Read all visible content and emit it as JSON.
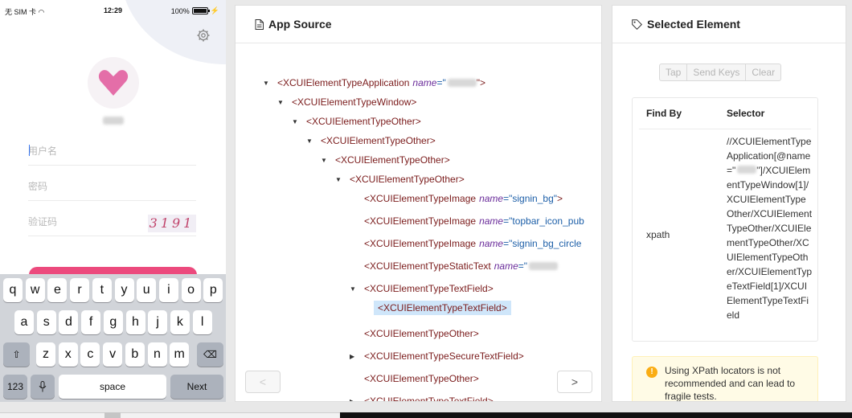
{
  "phone": {
    "status": {
      "carrier": "无 SIM 卡",
      "time": "12:29",
      "battery": "100%"
    },
    "fields": {
      "username_placeholder": "用户名",
      "password_placeholder": "密码",
      "captcha_placeholder": "验证码",
      "captcha_image_text": "3191"
    },
    "keyboard": {
      "row1": [
        "q",
        "w",
        "e",
        "r",
        "t",
        "y",
        "u",
        "i",
        "o",
        "p"
      ],
      "row2": [
        "a",
        "s",
        "d",
        "f",
        "g",
        "h",
        "j",
        "k",
        "l"
      ],
      "row3": [
        "z",
        "x",
        "c",
        "v",
        "b",
        "n",
        "m"
      ],
      "num_key": "123",
      "space_key": "space",
      "next_key": "Next"
    }
  },
  "app_source": {
    "title": "App Source",
    "nodes": [
      {
        "tag": "<XCUIElementTypeApplication",
        "attr": "name",
        "val": "=\"",
        "blur": true,
        "end": "\">",
        "arrow": "down"
      },
      {
        "tag": "<XCUIElementTypeWindow>",
        "arrow": "down"
      },
      {
        "tag": "<XCUIElementTypeOther>",
        "arrow": "down"
      },
      {
        "tag": "<XCUIElementTypeOther>",
        "arrow": "down"
      },
      {
        "tag": "<XCUIElementTypeOther>",
        "arrow": "down"
      },
      {
        "tag": "<XCUIElementTypeOther>",
        "arrow": "down"
      },
      {
        "tag": "<XCUIElementTypeImage",
        "attr": "name",
        "val": "=\"signin_bg\"",
        "end": ">"
      },
      {
        "tag": "<XCUIElementTypeImage",
        "attr": "name",
        "val": "=\"topbar_icon_pub",
        "end": ""
      },
      {
        "tag": "<XCUIElementTypeImage",
        "attr": "name",
        "val": "=\"signin_bg_circle",
        "end": ""
      },
      {
        "tag": "<XCUIElementTypeStaticText",
        "attr": "name",
        "val": "=\"",
        "blur": true,
        "end": ""
      },
      {
        "tag": "<XCUIElementTypeTextField>",
        "arrow": "down"
      },
      {
        "tag": "<XCUIElementTypeTextField>",
        "highlight": true
      },
      {
        "tag": "<XCUIElementTypeOther>"
      },
      {
        "tag": "<XCUIElementTypeSecureTextField>",
        "arrow": "right"
      },
      {
        "tag": "<XCUIElementTypeOther>"
      },
      {
        "tag": "<XCUIElementTypeTextField>",
        "arrow": "right"
      }
    ],
    "prev": "<",
    "next": ">"
  },
  "selected": {
    "title": "Selected Element",
    "actions": [
      "Tap",
      "Send Keys",
      "Clear"
    ],
    "table": {
      "col_find_by": "Find By",
      "col_selector": "Selector",
      "find_by": "xpath",
      "selector_pre": "//XCUIElementTypeApplication[@name=\"",
      "selector_post": "\"]/XCUIElementTypeWindow[1]/XCUIElementTypeOther/XCUIElementTypeOther/XCUIElementTypeOther/XCUIElementTypeOther/XCUIElementTypeTextField[1]/XCUIElementTypeTextField"
    },
    "warning": "Using XPath locators is not recommended and can lead to fragile tests."
  },
  "colors": {
    "accent_pink": "#ec4a7d",
    "highlight": "#cfe6fa",
    "warn": "#faad14"
  }
}
